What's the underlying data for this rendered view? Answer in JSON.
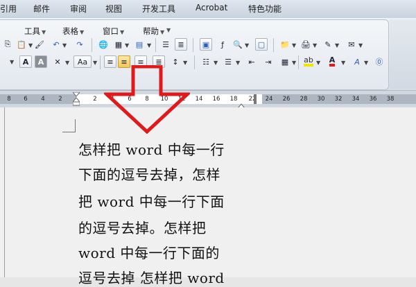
{
  "ribbon_tabs": [
    "引用",
    "邮件",
    "审阅",
    "视图",
    "开发工具",
    "Acrobat",
    "特色功能"
  ],
  "menus": [
    "工具",
    "表格",
    "窗口",
    "帮助"
  ],
  "ruler": {
    "numbers": [
      "8",
      "6",
      "4",
      "2",
      "2",
      "4",
      "6",
      "8",
      "10",
      "12",
      "14",
      "16",
      "18",
      "22",
      "24",
      "26",
      "28",
      "30",
      "32",
      "34",
      "36",
      "38"
    ]
  },
  "document": {
    "lines": [
      "怎样把 word 中每一行",
      "下面的逗号去掉，怎样",
      "把 word 中每一行下面",
      "的逗号去掉。怎样把",
      "word 中每一行下面的",
      "逗号去掉 怎样把 word"
    ]
  },
  "colors": {
    "arrow": "#e0191b",
    "highlight": "#f0e400",
    "font_color": "#e0191b"
  },
  "icons": {
    "font_color_letter": "A",
    "change_case": "Aa"
  }
}
